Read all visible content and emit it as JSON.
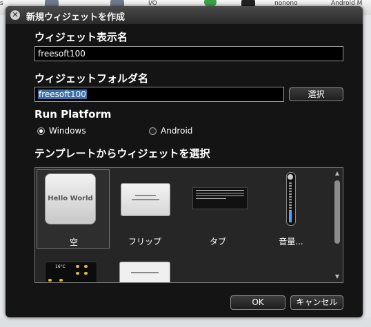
{
  "background_app": {
    "toolbar_labels": [
      "s",
      "",
      "",
      "I/O",
      "",
      "",
      "nonono",
      "Android M"
    ]
  },
  "dialog": {
    "title": "新規ウィジェットを作成",
    "close_symbol": "✕",
    "display_name": {
      "label": "ウィジェット表示名",
      "value": "freesoft100"
    },
    "folder_name": {
      "label": "ウィジェットフォルダ名",
      "value": "freesoft100",
      "browse_button": "選択"
    },
    "run_platform": {
      "label": "Run Platform",
      "options": [
        {
          "label": "Windows",
          "checked": true
        },
        {
          "label": "Android",
          "checked": false
        }
      ]
    },
    "template": {
      "label": "テンプレートからウィジェットを選択",
      "items": [
        {
          "label": "空",
          "thumb_text": "Hello World",
          "selected": true
        },
        {
          "label": "フリップ",
          "selected": false
        },
        {
          "label": "タブ",
          "selected": false
        },
        {
          "label": "音量...",
          "selected": false
        }
      ],
      "weather_temp": "16°C"
    },
    "ok_button": "OK",
    "cancel_button": "キャンセル"
  },
  "colors": {
    "dialog_bg": "#141414",
    "selection_highlight": "#3a6ea5",
    "volume_accent": "#4aa8ff"
  }
}
